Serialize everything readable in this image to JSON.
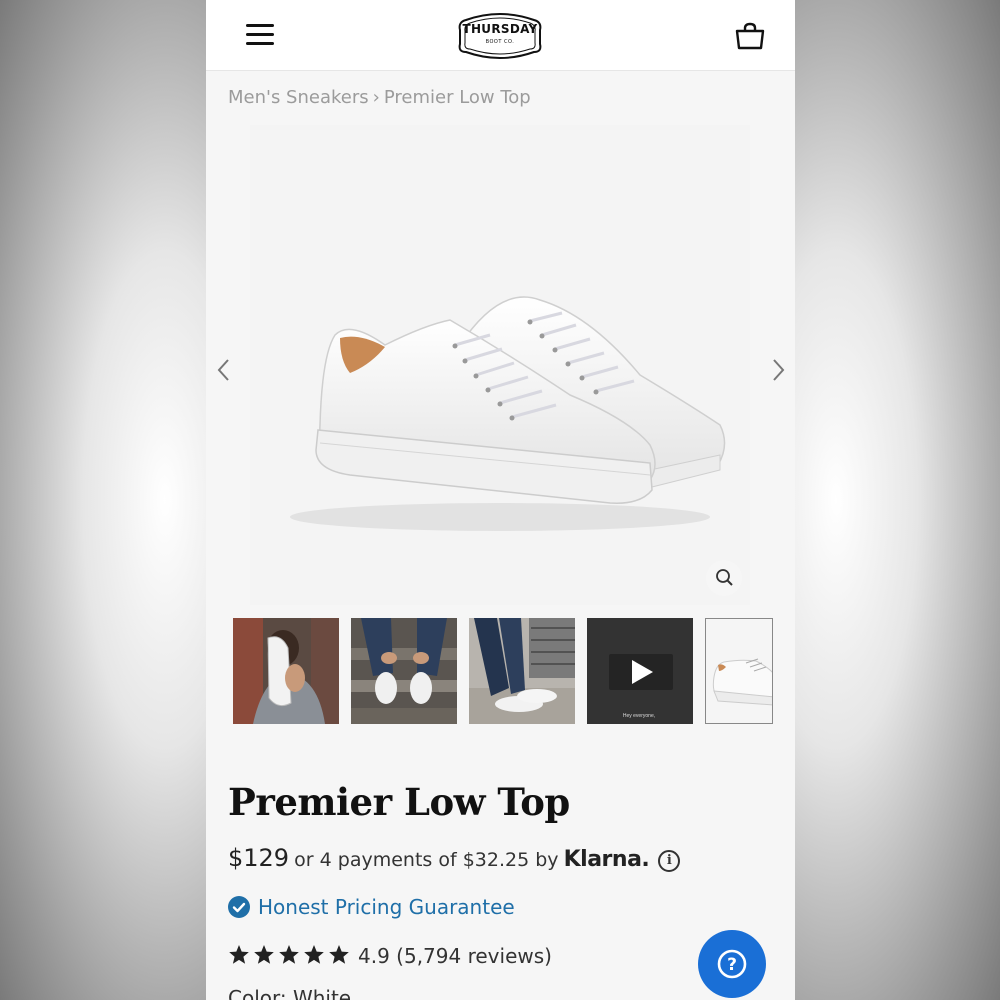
{
  "header": {
    "menu_icon": "hamburger-icon",
    "logo_text": "THURSDAY",
    "logo_sub": "BOOT CO.",
    "cart_icon": "shopping-bag-icon"
  },
  "breadcrumb": {
    "items": [
      "Men's Sneakers",
      "Premier Low Top"
    ],
    "separator": "›"
  },
  "gallery": {
    "prev_icon": "chevron-left-icon",
    "next_icon": "chevron-right-icon",
    "zoom_icon": "zoom-icon",
    "thumbnails": [
      {
        "type": "photo",
        "icon": "sneaker-photo"
      },
      {
        "type": "photo",
        "icon": "sneaker-photo"
      },
      {
        "type": "photo",
        "icon": "sneaker-photo"
      },
      {
        "type": "video",
        "icon": "play-icon",
        "caption": "Hey everyone,"
      },
      {
        "type": "photo",
        "icon": "sneaker-photo",
        "selected": true
      }
    ]
  },
  "product": {
    "title": "Premier Low Top",
    "price": "$129",
    "installments": "or 4 payments of $32.25 by",
    "klarna": "Klarna.",
    "info_icon_label": "i",
    "guarantee": "Honest Pricing Guarantee",
    "rating": "4.9",
    "reviews": "(5,794 reviews)",
    "stars": 5,
    "color_label": "Color: White"
  },
  "help_button": {
    "icon": "help-icon",
    "label": "?"
  },
  "colors": {
    "accent": "#1f6fa8",
    "help": "#1a6fd6",
    "text": "#111111"
  }
}
